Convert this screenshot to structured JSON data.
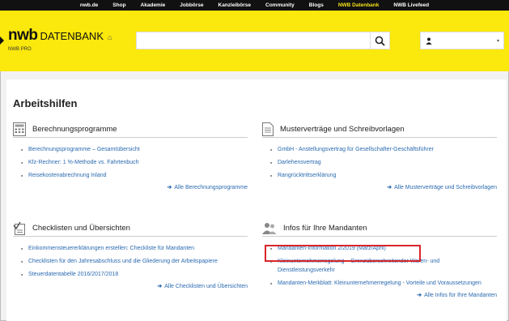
{
  "topnav": [
    "nwb.de",
    "Shop",
    "Akademie",
    "Jobbörse",
    "Kanzleibörse",
    "Community",
    "Blogs",
    "NWB Datenbank",
    "NWB Livefeed"
  ],
  "header": {
    "logo_nwb": "nwb",
    "logo_db": "DATENBANK",
    "home_icon": "⌂",
    "subbrand": "NWB PRO",
    "search_placeholder": "",
    "user_caret": "▾"
  },
  "page": {
    "title": "Arbeitshilfen"
  },
  "sections": [
    {
      "title": "Berechnungsprogramme",
      "icon": "calculator-icon",
      "items": [
        "Berechnungsprogramme – Gesamtübersicht",
        "Kfz-Rechner: 1 %-Methode vs. Fahrtenbuch",
        "Reisekostenabrechnung Inland"
      ],
      "all_link": "Alle Berechnungsprogramme"
    },
    {
      "title": "Musterverträge und Schreibvorlagen",
      "icon": "document-icon",
      "items": [
        "GmbH - Anstellungsvertrag für Gesellschafter-Geschäftsführer",
        "Darlehensvertrag",
        "Rangrücktrittserklärung"
      ],
      "all_link": "Alle Musterverträge und Schreibvorlagen"
    },
    {
      "title": "Checklisten und Übersichten",
      "icon": "checklist-icon",
      "items": [
        "Einkommensteuererklärungen erstellen: Checkliste für Mandanten",
        "Checklisten für den Jahresabschluss und die Gliederung der Arbeitspapiere",
        "Steuerdatentabelle 2016/2017/2018"
      ],
      "all_link": "Alle Checklisten und Übersichten"
    },
    {
      "title": "Infos für Ihre Mandanten",
      "icon": "people-icon",
      "items": [
        "Mandanten-Information 2/2019 (März/April)",
        "Kleinunternehmerregelung – Grenzüberschreitender Waren- und Dienstleistungsverkehr",
        "Mandanten-Merkblatt: Kleinunternehmerregelung - Vorteile und Voraussetzungen"
      ],
      "all_link": "Alle Infos für Ihre Mandanten"
    }
  ],
  "arrow": "➔",
  "colors": {
    "brand_yellow": "#fbe80c",
    "nav_active": "#f5e11a",
    "link": "#2a6ab0",
    "highlight": "#d8262b"
  }
}
